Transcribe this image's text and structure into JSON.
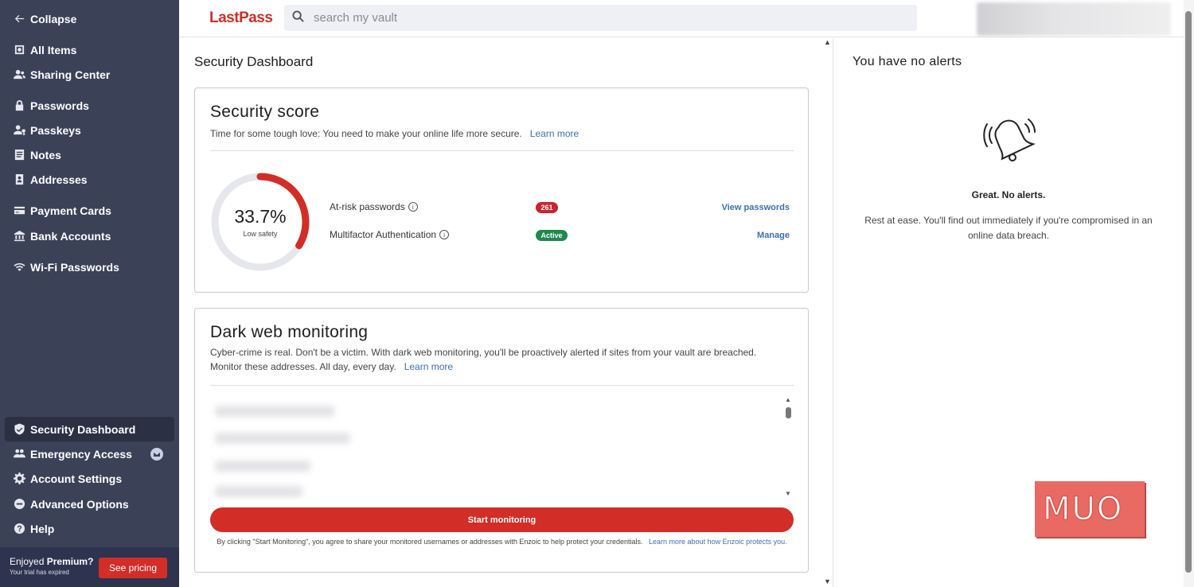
{
  "sidebar": {
    "items": [
      {
        "label": "Collapse",
        "icon": "arrow-left-icon"
      },
      {
        "label": "All Items",
        "icon": "vault-icon"
      },
      {
        "label": "Sharing Center",
        "icon": "people-icon"
      },
      {
        "label": "Passwords",
        "icon": "lock-icon"
      },
      {
        "label": "Passkeys",
        "icon": "passkey-icon"
      },
      {
        "label": "Notes",
        "icon": "note-icon"
      },
      {
        "label": "Addresses",
        "icon": "address-icon"
      },
      {
        "label": "Payment Cards",
        "icon": "card-icon"
      },
      {
        "label": "Bank Accounts",
        "icon": "bank-icon"
      },
      {
        "label": "Wi-Fi Passwords",
        "icon": "wifi-icon"
      },
      {
        "label": "Security Dashboard",
        "icon": "shield-icon",
        "active": true
      },
      {
        "label": "Emergency Access",
        "icon": "emergency-icon"
      },
      {
        "label": "Account Settings",
        "icon": "gear-icon"
      },
      {
        "label": "Advanced Options",
        "icon": "advanced-icon"
      },
      {
        "label": "Help",
        "icon": "help-icon"
      }
    ],
    "premium": {
      "prefix": "Enjoyed",
      "bold": "Premium?",
      "subtitle": "Your trial has expired",
      "button": "See pricing"
    }
  },
  "header": {
    "logo": "LastPass",
    "search_placeholder": "search my vault"
  },
  "main": {
    "page_title": "Security Dashboard",
    "security_score": {
      "title": "Security score",
      "description": "Time for some tough love: You need to make your online life more secure.",
      "learn_more": "Learn more",
      "score": "33.7%",
      "score_fraction": 0.337,
      "score_label": "Low safety",
      "metrics": [
        {
          "label": "At-risk passwords",
          "badge": "261",
          "action": "View passwords"
        },
        {
          "label": "Multifactor Authentication",
          "badge": "Active",
          "action": "Manage"
        }
      ]
    },
    "dark_web": {
      "title": "Dark web monitoring",
      "description": "Cyber-crime is real. Don't be a victim. With dark web monitoring, you'll be proactively alerted if sites from your vault are breached. Monitor these addresses. All day, every day.",
      "learn_more": "Learn more",
      "button": "Start monitoring",
      "fineprint": "By clicking \"Start Monitoring\", you agree to share your monitored usernames or addresses with Enzoic to help protect your credentials.",
      "fineprint_link": "Learn more about how Enzoic protects you."
    }
  },
  "alerts": {
    "title": "You have no alerts",
    "headline": "Great. No alerts.",
    "body": "Rest at ease. You'll find out immediately if you're compromised in an online data breach."
  },
  "watermark": "MUO",
  "colors": {
    "sidebar_bg": "#3b4157",
    "brand_red": "#d32d27",
    "link_blue": "#3b6fb5",
    "badge_green": "#1d8a4d"
  }
}
